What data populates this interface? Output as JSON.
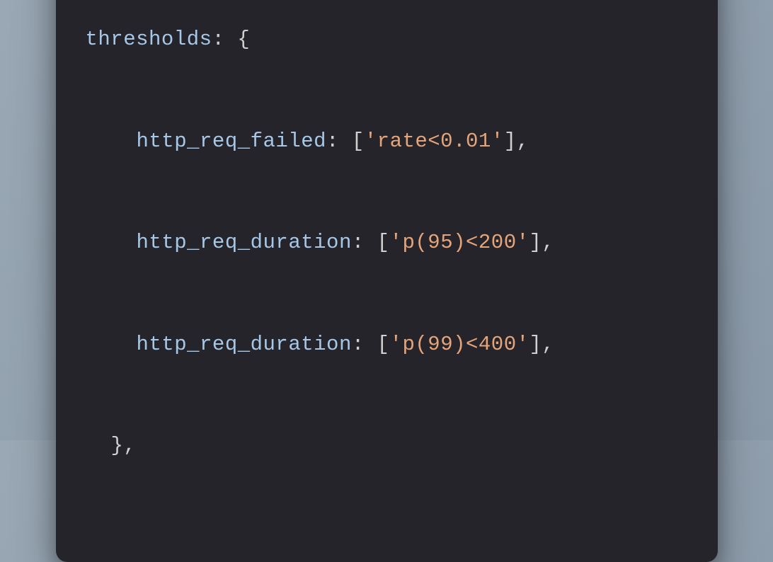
{
  "code": {
    "line1_key": "thresholds",
    "line1_after": ": {",
    "line2_key": "http_req_failed",
    "line2_after1": ": [",
    "line2_str": "'rate<0.01'",
    "line2_after2": "],",
    "line3_key": "http_req_duration",
    "line3_after1": ": [",
    "line3_str": "'p(95)<200'",
    "line3_after2": "],",
    "line4_key": "http_req_duration",
    "line4_after1": ": [",
    "line4_str": "'p(99)<400'",
    "line4_after2": "],",
    "line5": "},"
  },
  "colors": {
    "bg": "#24242a",
    "key": "#a7c7e7",
    "punc": "#d0d0d0",
    "str": "#e6a47a",
    "red": "#ff5f57",
    "yellow": "#febc2e",
    "green": "#28c840"
  }
}
